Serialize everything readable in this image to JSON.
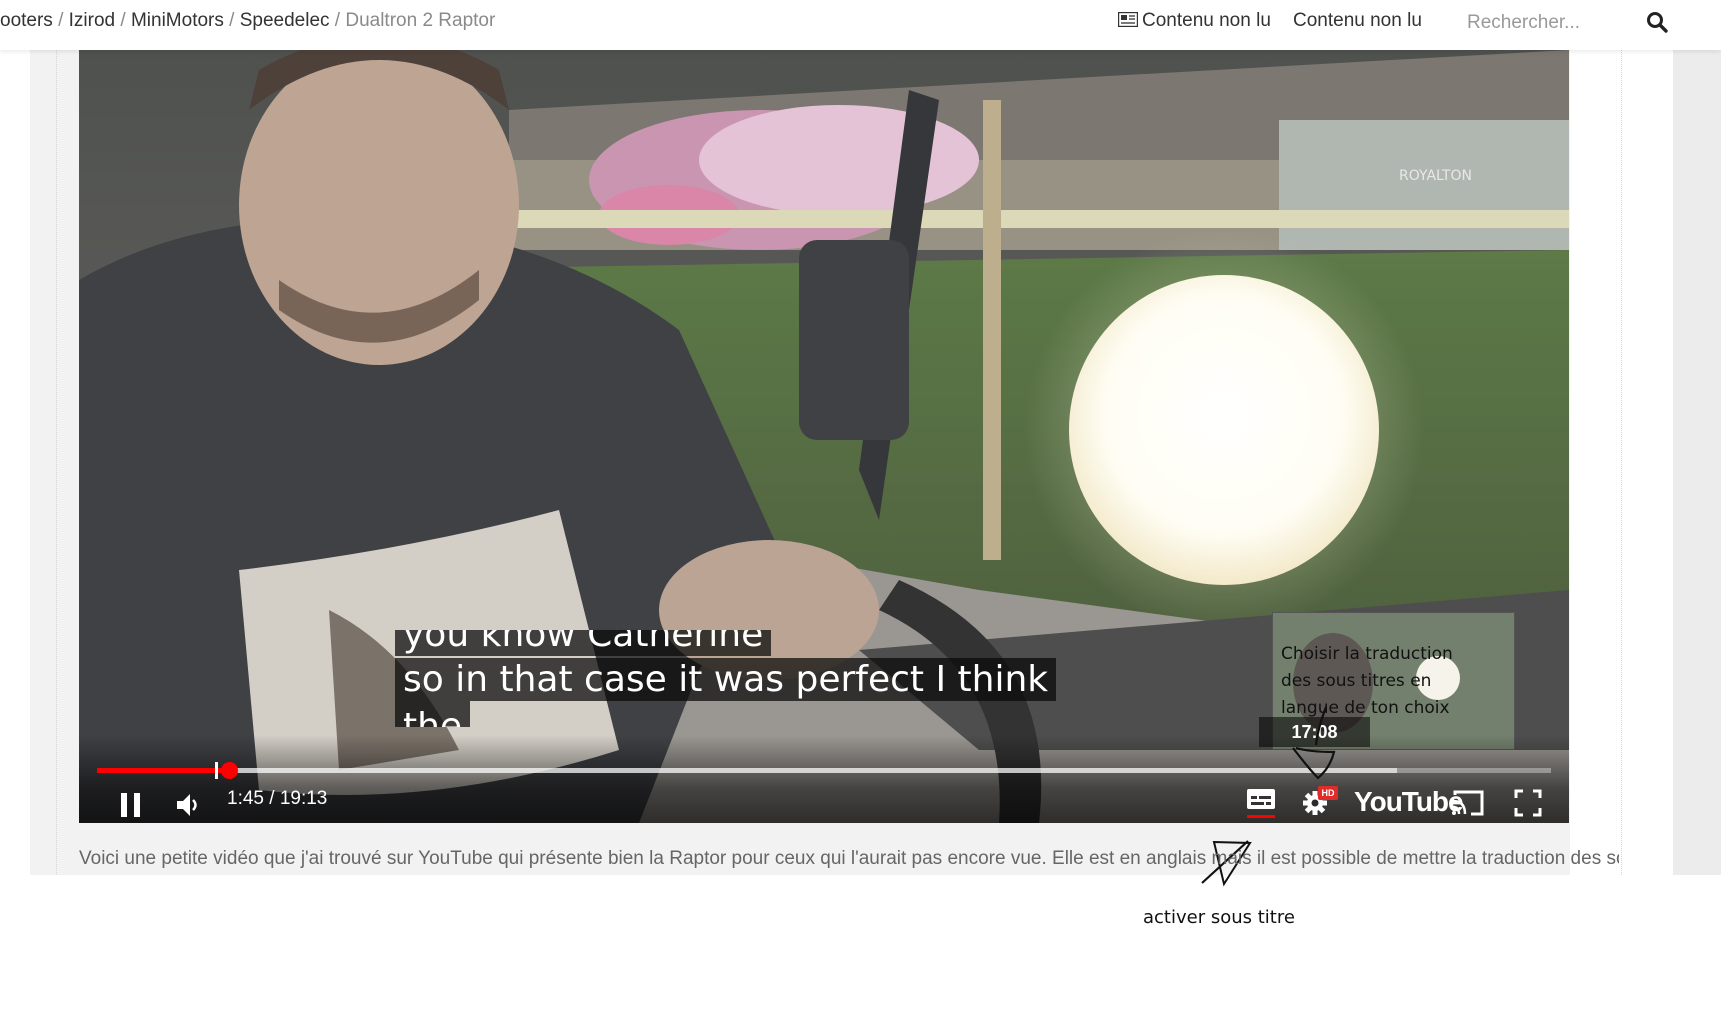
{
  "breadcrumb": {
    "cut_item": "ooters",
    "separator": "/",
    "items": [
      "Izirod",
      "MiniMotors",
      "Speedelec"
    ],
    "current": "Dualtron 2 Raptor"
  },
  "header": {
    "unread_1": "Contenu non lu",
    "unread_2": "Contenu non lu",
    "search_placeholder": "Rechercher...",
    "icons": {
      "news": "newspaper-icon",
      "search": "search-icon"
    }
  },
  "video": {
    "captions": {
      "line_top_partial": "you know Catherine",
      "line_main": "so in that case it was perfect I think",
      "line_bottom_partial": "the"
    },
    "preview_time": "17:08",
    "time_current": "1:45",
    "time_total": "19:13",
    "time_separator": " / ",
    "progress_played": 0.091,
    "progress_buffered": 0.894,
    "controls": {
      "pause": "pause-icon",
      "volume": "volume-icon",
      "subtitles": "subtitles-icon",
      "settings": "settings-gear-icon",
      "hd_badge": "HD",
      "brand": "YouTube",
      "cast": "cast-icon",
      "fullscreen": "fullscreen-icon"
    },
    "colors": {
      "progress": "#ff0000",
      "hd_badge": "#e12b2b"
    }
  },
  "annotations": {
    "callout": "Choisir la traduction des sous titres en langue de ton choix",
    "subtitle_hint": "activer sous titre"
  },
  "description": "Voici une petite vidéo que j'ai trouvé sur YouTube qui présente bien la Raptor pour ceux qui l'aurait pas encore vue. Elle est en anglais mais il est possible de mettre la traduction des sous titres..."
}
